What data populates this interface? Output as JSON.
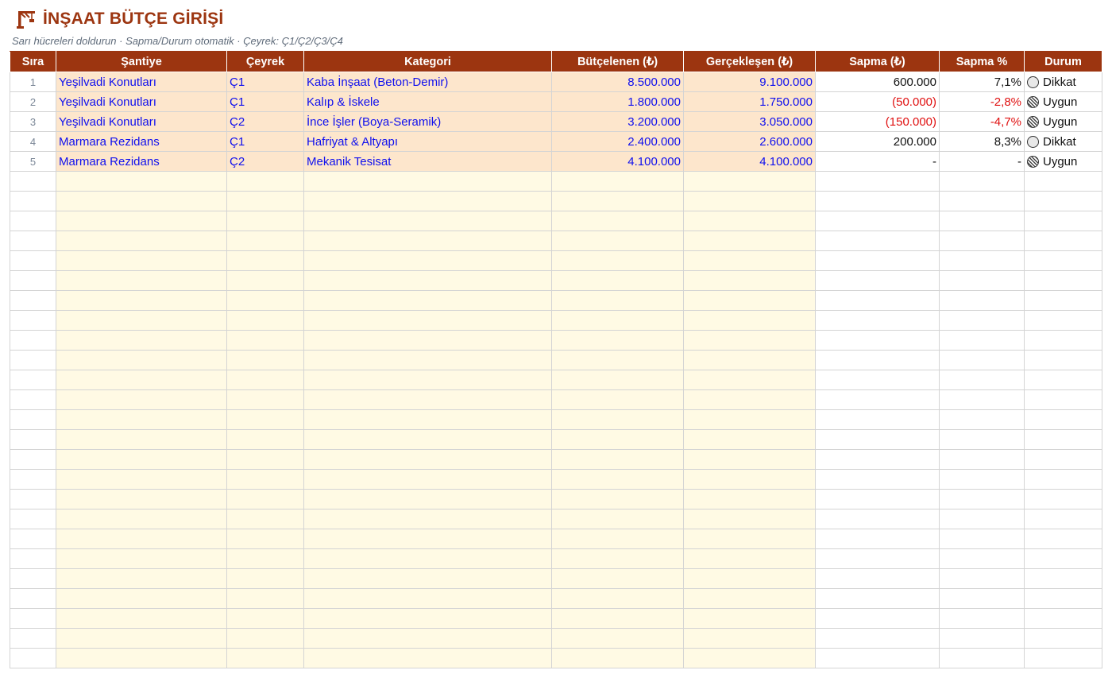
{
  "header": {
    "title": "İNŞAAT BÜTÇE GİRİŞİ",
    "subtitle": "Sarı hücreleri doldurun · Sapma/Durum otomatik · Çeyrek: Ç1/Ç2/Ç3/Ç4"
  },
  "columns": [
    "Sıra",
    "Şantiye",
    "Çeyrek",
    "Kategori",
    "Bütçelenen (₺)",
    "Gerçekleşen (₺)",
    "Sapma (₺)",
    "Sapma %",
    "Durum"
  ],
  "rows": [
    {
      "idx": "1",
      "site": "Yeşilvadi Konutları",
      "quarter": "Ç1",
      "category": "Kaba İnşaat (Beton-Demir)",
      "budget": "8.500.000",
      "actual": "9.100.000",
      "variance": "600.000",
      "variance_pct": "7,1%",
      "status": "Dikkat",
      "status_icon": "caution-circle-icon",
      "negative": false
    },
    {
      "idx": "2",
      "site": "Yeşilvadi Konutları",
      "quarter": "Ç1",
      "category": "Kalıp & İskele",
      "budget": "1.800.000",
      "actual": "1.750.000",
      "variance": "(50.000)",
      "variance_pct": "-2,8%",
      "status": "Uygun",
      "status_icon": "ok-circle-icon",
      "negative": true
    },
    {
      "idx": "3",
      "site": "Yeşilvadi Konutları",
      "quarter": "Ç2",
      "category": "İnce İşler (Boya-Seramik)",
      "budget": "3.200.000",
      "actual": "3.050.000",
      "variance": "(150.000)",
      "variance_pct": "-4,7%",
      "status": "Uygun",
      "status_icon": "ok-circle-icon",
      "negative": true
    },
    {
      "idx": "4",
      "site": "Marmara Rezidans",
      "quarter": "Ç1",
      "category": "Hafriyat & Altyapı",
      "budget": "2.400.000",
      "actual": "2.600.000",
      "variance": "200.000",
      "variance_pct": "8,3%",
      "status": "Dikkat",
      "status_icon": "caution-circle-icon",
      "negative": false
    },
    {
      "idx": "5",
      "site": "Marmara Rezidans",
      "quarter": "Ç2",
      "category": "Mekanik Tesisat",
      "budget": "4.100.000",
      "actual": "4.100.000",
      "variance": "-",
      "variance_pct": "-",
      "status": "Uygun",
      "status_icon": "ok-circle-icon",
      "negative": false
    }
  ],
  "colors": {
    "header_bg": "#9c3510",
    "input_filled_bg": "#fde6cc",
    "input_empty_bg": "#fffae4",
    "input_text": "#1010ee",
    "negative_text": "#e01010"
  }
}
